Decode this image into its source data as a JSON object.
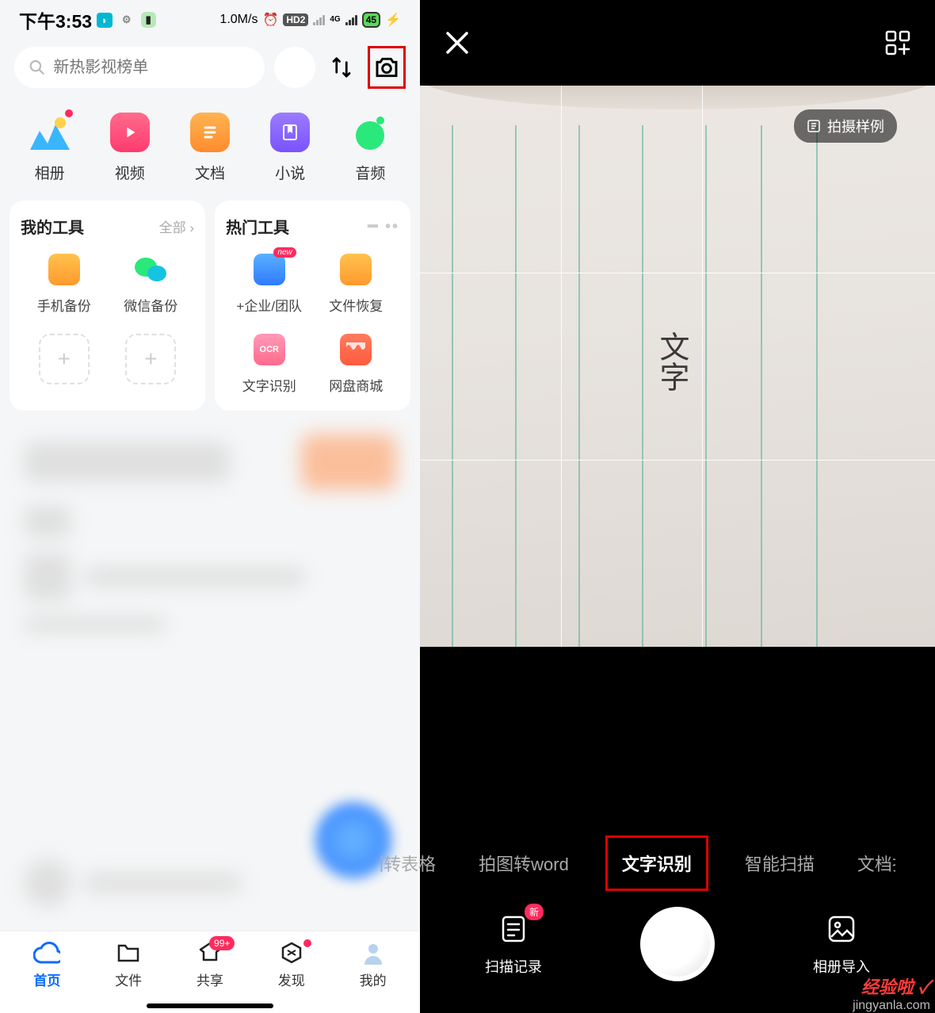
{
  "status": {
    "time": "下午3:53",
    "speed": "1.0M/s",
    "hd": "HD2",
    "net": "4G",
    "battery": "45"
  },
  "search": {
    "placeholder": "新热影视榜单"
  },
  "categories": [
    {
      "label": "相册"
    },
    {
      "label": "视频"
    },
    {
      "label": "文档"
    },
    {
      "label": "小说"
    },
    {
      "label": "音频"
    }
  ],
  "myTools": {
    "title": "我的工具",
    "more": "全部",
    "items": [
      {
        "label": "手机备份"
      },
      {
        "label": "微信备份"
      }
    ]
  },
  "hotTools": {
    "title": "热门工具",
    "items": [
      {
        "label": "+企业/团队",
        "badge": "new"
      },
      {
        "label": "文件恢复"
      },
      {
        "label": "文字识别"
      },
      {
        "label": "网盘商城"
      }
    ]
  },
  "nav": [
    {
      "label": "首页"
    },
    {
      "label": "文件"
    },
    {
      "label": "共享",
      "badge": "99+"
    },
    {
      "label": "发现"
    },
    {
      "label": "我的"
    }
  ],
  "camera": {
    "sampleChip": "拍摄样例",
    "handwriting": "文字",
    "modes": [
      "拍图转表格",
      "拍图转word",
      "文字识别",
      "智能扫描",
      "文档扫描"
    ],
    "history": {
      "label": "扫描记录",
      "badge": "新"
    },
    "import": {
      "label": "相册导入"
    }
  },
  "watermark": {
    "brand": "经验啦",
    "url": "jingyanla.com"
  }
}
